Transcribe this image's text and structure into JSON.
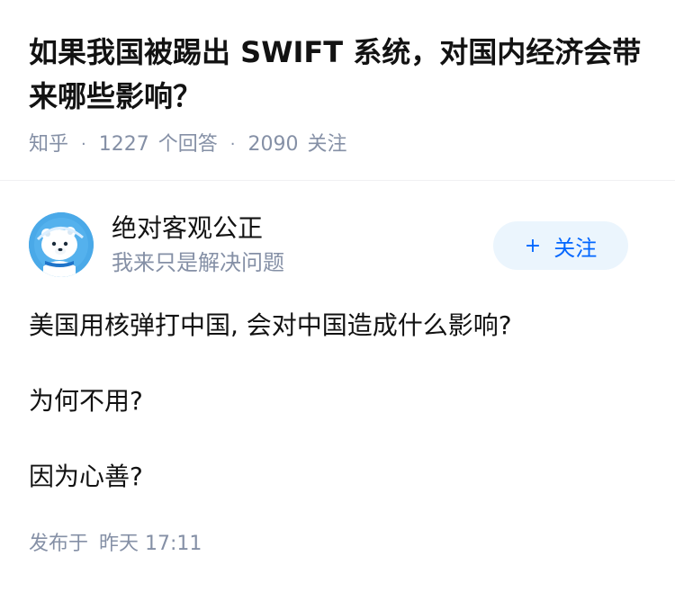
{
  "question": {
    "title": "如果我国被踢出 SWIFT 系统，对国内经济会带来哪些影响？",
    "source": "知乎",
    "answer_count": "1227",
    "answer_label": "个回答",
    "follower_count": "2090",
    "follower_label": "关注",
    "separator": "·"
  },
  "author": {
    "name": "绝对客观公正",
    "headline": "我来只是解决问题",
    "avatar_icon": "polar-bear-avatar-icon",
    "follow_label": "关注",
    "follow_icon": "plus-icon"
  },
  "answer": {
    "paragraphs": [
      "美国用核弹打中国, 会对中国造成什么影响?",
      "为何不用?",
      "因为心善?"
    ],
    "published_label": "发布于",
    "published_time": "昨天 17:11"
  },
  "colors": {
    "primary_text": "#121212",
    "secondary_text": "#8590a6",
    "accent": "#0066ff",
    "follow_bg": "#ebf5fd",
    "avatar_bg": "#49a8e6"
  }
}
